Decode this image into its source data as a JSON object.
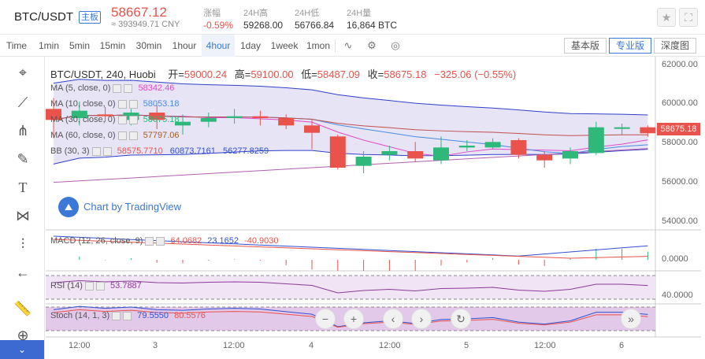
{
  "header": {
    "pair": "BTC/USDT",
    "badge": "主板",
    "price": "58667.12",
    "cny": "≈ 393949.71 CNY",
    "change_label": "涨幅",
    "change_value": "-0.59%",
    "high_label": "24H高",
    "high_value": "59268.00",
    "low_label": "24H低",
    "low_value": "56766.84",
    "vol_label": "24H量",
    "vol_value": "16,864 BTC",
    "star_icon": "star-icon",
    "expand_icon": "fullscreen-icon"
  },
  "toolbar": {
    "intervals": [
      "Time",
      "1min",
      "5min",
      "15min",
      "30min",
      "1hour",
      "4hour",
      "1day",
      "1week",
      "1mon"
    ],
    "active_interval": "4hour",
    "versions": [
      "基本版",
      "专业版",
      "深度图"
    ],
    "active_version": "专业版"
  },
  "chart": {
    "title": "BTC/USDT, 240, Huobi",
    "ohlc": {
      "open_label": "开=",
      "open": "59000.24",
      "high_label": "高=",
      "high": "59100.00",
      "low_label": "低=",
      "low": "58487.09",
      "close_label": "收=",
      "close": "58675.18",
      "change": "−325.06 (−0.55%)"
    },
    "ma5": {
      "label": "MA (5, close, 0)",
      "value": "58342.46"
    },
    "ma10": {
      "label": "MA (10, close, 0)",
      "value": "58053.18"
    },
    "ma30": {
      "label": "MA (30, close, 0)",
      "value": "58675.18"
    },
    "ma60": {
      "label": "MA (60, close, 0)",
      "value": "57797.06"
    },
    "bb": {
      "label": "BB (30, 3)",
      "v1": "58575.7710",
      "v2": "60873.7161",
      "v3": "56277.8259"
    },
    "watermark": "Chart by TradingView",
    "current_tag": "58675.18",
    "price_axis": [
      "62000.00",
      "60000.00",
      "58000.00",
      "56000.00",
      "54000.00"
    ],
    "macd": {
      "label": "MACD (12, 26, close, 9)",
      "v1": "64.0682",
      "v2": "23.1652",
      "v3": "-40.9030",
      "axis": "0.0000"
    },
    "rsi": {
      "label": "RSI (14)",
      "value": "53.7887",
      "axis": "40.0000"
    },
    "stoch": {
      "label": "Stoch (14, 1, 3)",
      "v1": "79.5550",
      "v2": "80.5576"
    },
    "time_axis": [
      "12:00",
      "3",
      "12:00",
      "4",
      "12:00",
      "5",
      "12:00",
      "6"
    ]
  },
  "chart_data": {
    "type": "candlestick",
    "title": "BTC/USDT, 240, Huobi",
    "ylim": [
      53500,
      62500
    ],
    "candles": [
      {
        "o": 60000,
        "c": 59400,
        "h": 60600,
        "l": 58400
      },
      {
        "o": 59500,
        "c": 59900,
        "h": 60400,
        "l": 59100
      },
      {
        "o": 59700,
        "c": 59600,
        "h": 60100,
        "l": 59300
      },
      {
        "o": 59400,
        "c": 59800,
        "h": 60000,
        "l": 59100
      },
      {
        "o": 59800,
        "c": 59400,
        "h": 60200,
        "l": 58900
      },
      {
        "o": 59100,
        "c": 59300,
        "h": 59700,
        "l": 58600
      },
      {
        "o": 59300,
        "c": 59500,
        "h": 59800,
        "l": 59000
      },
      {
        "o": 59500,
        "c": 59600,
        "h": 60000,
        "l": 59200
      },
      {
        "o": 59600,
        "c": 59500,
        "h": 59900,
        "l": 59100
      },
      {
        "o": 59500,
        "c": 59100,
        "h": 59700,
        "l": 58900
      },
      {
        "o": 59100,
        "c": 58700,
        "h": 59400,
        "l": 57800
      },
      {
        "o": 58500,
        "c": 56800,
        "h": 58600,
        "l": 56700
      },
      {
        "o": 56900,
        "c": 57400,
        "h": 57700,
        "l": 56500
      },
      {
        "o": 57500,
        "c": 57700,
        "h": 58000,
        "l": 57200
      },
      {
        "o": 57700,
        "c": 57300,
        "h": 58200,
        "l": 57100
      },
      {
        "o": 57200,
        "c": 57900,
        "h": 58500,
        "l": 57000
      },
      {
        "o": 57900,
        "c": 58000,
        "h": 58300,
        "l": 57700
      },
      {
        "o": 57900,
        "c": 58200,
        "h": 58400,
        "l": 57800
      },
      {
        "o": 58300,
        "c": 57500,
        "h": 58400,
        "l": 57300
      },
      {
        "o": 57500,
        "c": 57200,
        "h": 57700,
        "l": 56800
      },
      {
        "o": 57300,
        "c": 57700,
        "h": 57900,
        "l": 57000
      },
      {
        "o": 57600,
        "c": 59000,
        "h": 59300,
        "l": 57500
      },
      {
        "o": 59000,
        "c": 59000,
        "h": 59200,
        "l": 58600
      },
      {
        "o": 59000,
        "c": 58675,
        "h": 59100,
        "l": 58487
      }
    ]
  }
}
